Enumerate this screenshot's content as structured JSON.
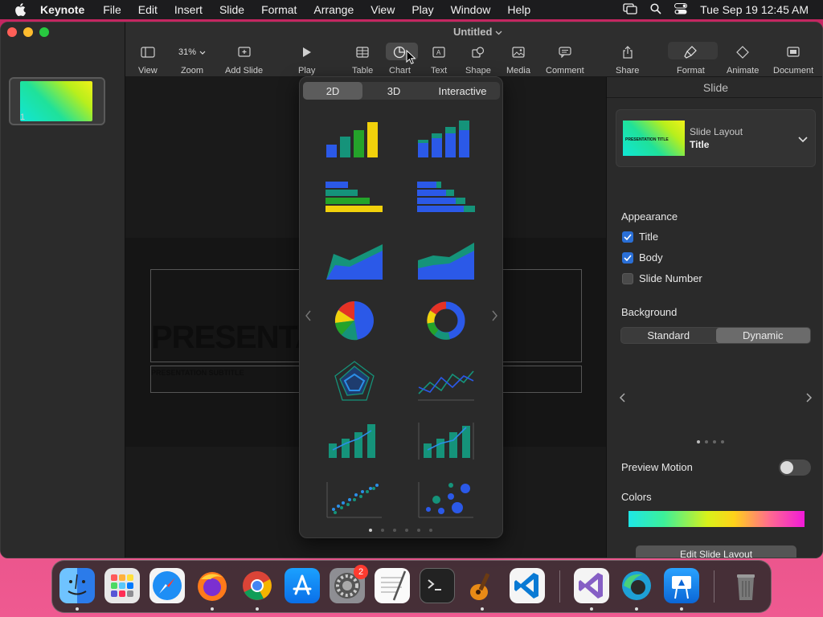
{
  "menubar": {
    "app_name": "Keynote",
    "items": [
      "File",
      "Edit",
      "Insert",
      "Slide",
      "Format",
      "Arrange",
      "View",
      "Play",
      "Window",
      "Help"
    ],
    "clock": "Tue Sep 19  12:45 AM"
  },
  "window": {
    "title": "Untitled",
    "slide_number": "1"
  },
  "toolbar": {
    "view": "View",
    "zoom_value": "31%",
    "zoom": "Zoom",
    "add_slide": "Add Slide",
    "play": "Play",
    "table": "Table",
    "chart": "Chart",
    "text": "Text",
    "shape": "Shape",
    "media": "Media",
    "comment": "Comment",
    "share": "Share",
    "format": "Format",
    "animate": "Animate",
    "document": "Document"
  },
  "slide": {
    "title_text": "PRESENTATION TITLE",
    "subtitle_text": "PRESENTATION SUBTITLE"
  },
  "chart_popover": {
    "tabs": [
      "2D",
      "3D",
      "Interactive"
    ],
    "selected_tab": "2D",
    "chart_types": [
      "column",
      "stacked-column",
      "bar",
      "stacked-bar",
      "area",
      "stacked-area",
      "pie",
      "donut",
      "radar",
      "line",
      "mixed",
      "2-axis",
      "scatter",
      "bubble"
    ]
  },
  "inspector": {
    "header": "Slide",
    "layout_label": "Slide Layout",
    "layout_value": "Title",
    "layout_thumb_text": "PRESENTATION TITLE",
    "appearance": "Appearance",
    "checkboxes": [
      {
        "label": "Title",
        "checked": true
      },
      {
        "label": "Body",
        "checked": true
      },
      {
        "label": "Slide Number",
        "checked": false
      }
    ],
    "background": "Background",
    "background_options": [
      "Standard",
      "Dynamic"
    ],
    "background_selected": "Dynamic",
    "preview_motion": "Preview Motion",
    "preview_motion_on": false,
    "colors": "Colors",
    "edit_layout": "Edit Slide Layout"
  },
  "dock": {
    "apps": [
      "Finder",
      "Launchpad",
      "Safari",
      "Firefox",
      "Chrome",
      "App Store",
      "System Settings",
      "TextEdit",
      "Terminal",
      "GarageBand",
      "Visual Studio Code",
      "Visual Studio",
      "Microsoft Edge",
      "Keynote",
      "Trash"
    ],
    "settings_badge": "2"
  },
  "colors": {
    "accent": "#2a6fd6",
    "chart_blue": "#2b59e8",
    "chart_teal": "#15937a",
    "chart_green": "#24a32a",
    "chart_yellow": "#f1d10b",
    "chart_red": "#e53224"
  }
}
